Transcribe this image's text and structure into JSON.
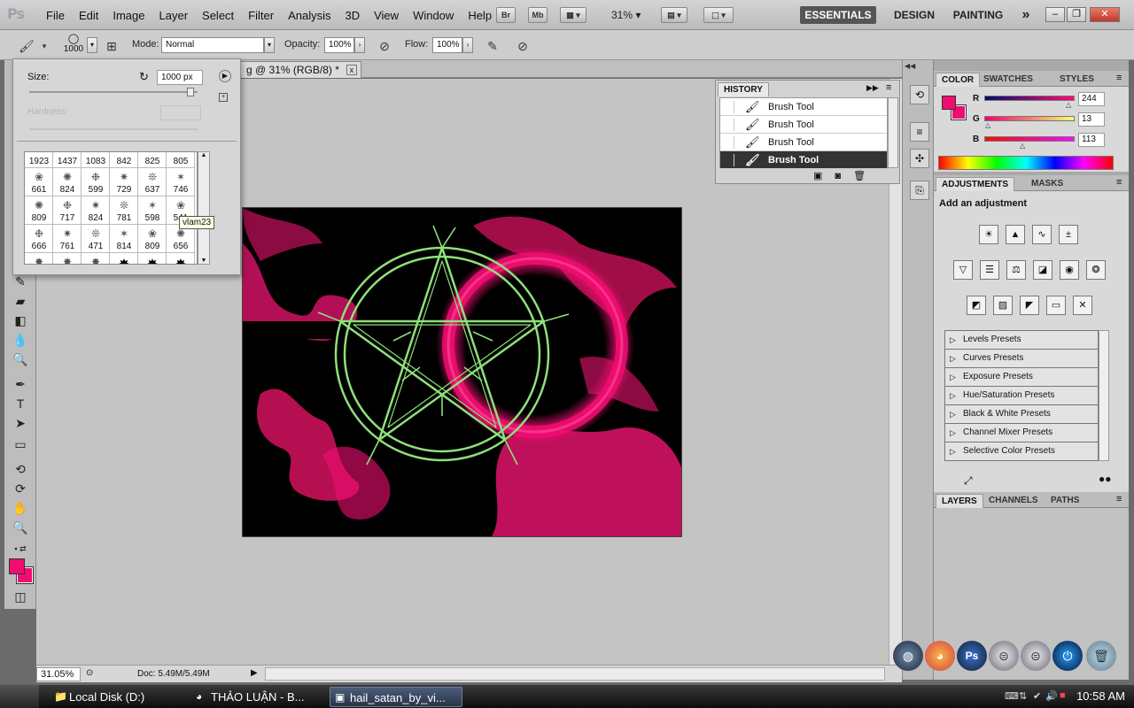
{
  "app": {
    "logo": "Ps"
  },
  "menubar": {
    "items": [
      "File",
      "Edit",
      "Image",
      "Layer",
      "Select",
      "Filter",
      "Analysis",
      "3D",
      "View",
      "Window",
      "Help"
    ],
    "bridge_label": "Br",
    "minibridge_label": "Mb",
    "zoom_label": "31%",
    "workspaces": [
      "ESSENTIALS",
      "DESIGN",
      "PAINTING"
    ],
    "more_label": "»"
  },
  "options": {
    "brush_size": "1000",
    "mode_label": "Mode:",
    "mode_value": "Normal",
    "opacity_label": "Opacity:",
    "opacity_value": "100%",
    "flow_label": "Flow:",
    "flow_value": "100%"
  },
  "brush_picker": {
    "size_label": "Size:",
    "size_value": "1000 px",
    "hardness_label": "Hardness:",
    "tooltip": "vlam23",
    "rows": [
      [
        "1923",
        "1437",
        "1083",
        "842",
        "825",
        "805"
      ],
      [
        "661",
        "824",
        "599",
        "729",
        "637",
        "746"
      ],
      [
        "809",
        "717",
        "824",
        "781",
        "598",
        "541"
      ],
      [
        "666",
        "761",
        "471",
        "814",
        "809",
        "656"
      ],
      [
        "",
        "",
        "",
        "",
        "",
        ""
      ]
    ]
  },
  "document": {
    "tab_title": "g @ 31% (RGB/8) *",
    "close_label": "x"
  },
  "status": {
    "zoom": "31.05%",
    "doc_info": "Doc: 5.49M/5.49M"
  },
  "history": {
    "tab": "HISTORY",
    "rows": [
      {
        "label": "Brush Tool",
        "active": false
      },
      {
        "label": "Brush Tool",
        "active": false
      },
      {
        "label": "Brush Tool",
        "active": false
      },
      {
        "label": "Brush Tool",
        "active": true
      }
    ]
  },
  "color_panel": {
    "tabs": [
      "COLOR",
      "SWATCHES",
      "STYLES"
    ],
    "foreground": "#f00d71",
    "background": "#f00d71",
    "channels": [
      {
        "label": "R",
        "value": "244"
      },
      {
        "label": "G",
        "value": "13"
      },
      {
        "label": "B",
        "value": "113"
      }
    ]
  },
  "adjustments": {
    "tabs": [
      "ADJUSTMENTS",
      "MASKS"
    ],
    "title": "Add an adjustment",
    "presets": [
      "Levels Presets",
      "Curves Presets",
      "Exposure Presets",
      "Hue/Saturation Presets",
      "Black & White Presets",
      "Channel Mixer Presets",
      "Selective Color Presets"
    ]
  },
  "layers_panel": {
    "tabs": [
      "LAYERS",
      "CHANNELS",
      "PATHS"
    ]
  },
  "taskbar": {
    "items": [
      {
        "label": "Local Disk (D:)",
        "icon": "folder-icon"
      },
      {
        "label": "THẢO LUẬN - B...",
        "icon": "firefox-icon"
      },
      {
        "label": "hail_satan_by_vi...",
        "icon": "photoshop-icon"
      }
    ],
    "time": "10:58 AM"
  },
  "colors": {
    "accent_pink": "#f00d71",
    "pentagram_green": "#8fe07a",
    "canvas_bg": "#000000"
  }
}
